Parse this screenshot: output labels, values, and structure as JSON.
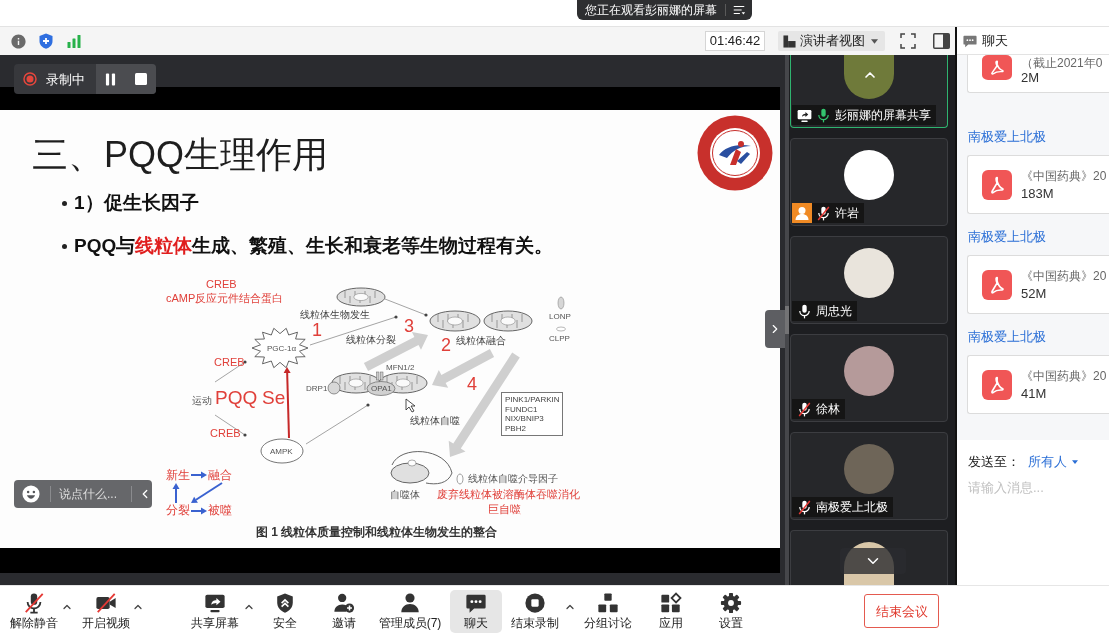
{
  "notification": {
    "text": "您正在观看彭丽娜的屏幕"
  },
  "toolbar": {
    "timer": "01:46:42",
    "view": "演讲者视图"
  },
  "recording": {
    "label": "录制中"
  },
  "slide": {
    "title": "三、PQQ生理作用",
    "bullets": [
      {
        "segments": [
          {
            "text": "1）促生长因子",
            "highlight": false
          }
        ]
      },
      {
        "segments": [
          {
            "text": "PQQ与",
            "highlight": false
          },
          {
            "text": "线粒体",
            "highlight": true
          },
          {
            "text": "生成、繁殖、生长和衰老等生物过程有关。",
            "highlight": false
          }
        ]
      }
    ],
    "figure": {
      "labels": [
        {
          "text": "CREB",
          "kind": "note"
        },
        {
          "text": "cAMP反应元件结合蛋白",
          "kind": "note"
        },
        {
          "text": "线粒体生物发生",
          "kind": "process"
        },
        {
          "text": "1",
          "kind": "step"
        },
        {
          "text": "PGC-1α",
          "kind": "gene"
        },
        {
          "text": "3",
          "kind": "step"
        },
        {
          "text": "线粒体分裂",
          "kind": "process"
        },
        {
          "text": "2",
          "kind": "step"
        },
        {
          "text": "线粒体融合",
          "kind": "process"
        },
        {
          "text": "LONP",
          "kind": "gene"
        },
        {
          "text": "CLPP",
          "kind": "gene"
        },
        {
          "text": "CREB",
          "kind": "note"
        },
        {
          "text": "MFN1/2",
          "kind": "gene"
        },
        {
          "text": "DRP1",
          "kind": "gene"
        },
        {
          "text": "OPA1",
          "kind": "gene"
        },
        {
          "text": "4",
          "kind": "step"
        },
        {
          "text": "线粒体自噬",
          "kind": "process"
        },
        {
          "text": "运动",
          "kind": "tag"
        },
        {
          "text": "PQQ",
          "kind": "agent"
        },
        {
          "text": "Se",
          "kind": "agent"
        },
        {
          "text": "CREB",
          "kind": "note"
        },
        {
          "text": "AMPK",
          "kind": "gene"
        },
        {
          "text": "新生",
          "kind": "cycle"
        },
        {
          "text": "融合",
          "kind": "cycle"
        },
        {
          "text": "线粒体自噬介导因子",
          "kind": "tag"
        },
        {
          "text": "自噬体",
          "kind": "tag"
        },
        {
          "text": "废弃线粒体被溶酶体吞噬消化",
          "kind": "note"
        },
        {
          "text": "分裂",
          "kind": "cycle"
        },
        {
          "text": "被噬",
          "kind": "cycle"
        },
        {
          "text": "巨自噬",
          "kind": "note"
        }
      ],
      "factors": [
        "PINK1/PARKIN",
        "FUNDC1",
        "NIX/BNIP3",
        "PBH2"
      ],
      "caption": "图 1 线粒体质量控制和线粒体生物发生的整合"
    }
  },
  "comment_box": {
    "placeholder": "说点什么..."
  },
  "participants": [
    {
      "name": "彭丽娜的屏幕共享",
      "kind": "screen_share",
      "muted": false,
      "speaking": true,
      "active": true,
      "person_badge": false
    },
    {
      "name": "许岩",
      "kind": "member",
      "muted": true,
      "speaking": false,
      "active": false,
      "person_badge": true
    },
    {
      "name": "周忠光",
      "kind": "member",
      "muted": false,
      "speaking": false,
      "active": false,
      "person_badge": false
    },
    {
      "name": "徐林",
      "kind": "member",
      "muted": true,
      "speaking": false,
      "active": false,
      "person_badge": false
    },
    {
      "name": "南极爱上北极",
      "kind": "member",
      "muted": true,
      "speaking": false,
      "active": false,
      "person_badge": false
    },
    {
      "kind": "member",
      "active": false
    }
  ],
  "chat": {
    "title": "聊天",
    "messages": [
      {
        "file": "（截止2021年0",
        "size": "2M"
      },
      {
        "sender": "南极爱上北极",
        "file": "《中国药典》20",
        "size": "183M"
      },
      {
        "sender": "南极爱上北极",
        "file": "《中国药典》20",
        "size": "52M"
      },
      {
        "sender": "南极爱上北极",
        "file": "《中国药典》20",
        "size": "41M"
      }
    ],
    "send_to": "发送至：",
    "recipient": "所有人",
    "placeholder": "请输入消息..."
  },
  "bottom_bar": {
    "items": [
      {
        "label": "解除静音",
        "off": true,
        "menu": true,
        "selected": false
      },
      {
        "label": "开启视频",
        "off": true,
        "menu": true,
        "selected": false
      },
      {
        "label": "共享屏幕",
        "off": false,
        "menu": true,
        "selected": false
      },
      {
        "label": "安全",
        "off": false,
        "menu": false,
        "selected": false
      },
      {
        "label": "邀请",
        "off": false,
        "menu": false,
        "selected": false
      },
      {
        "label": "管理成员(7)",
        "off": false,
        "menu": false,
        "selected": false
      },
      {
        "label": "聊天",
        "off": false,
        "menu": false,
        "selected": true
      },
      {
        "label": "结束录制",
        "off": false,
        "menu": true,
        "selected": false
      },
      {
        "label": "分组讨论",
        "off": false,
        "menu": false,
        "selected": false
      },
      {
        "label": "应用",
        "off": false,
        "menu": false,
        "selected": false
      },
      {
        "label": "设置",
        "off": false,
        "menu": false,
        "selected": false
      }
    ],
    "end_button": "结束会议"
  }
}
